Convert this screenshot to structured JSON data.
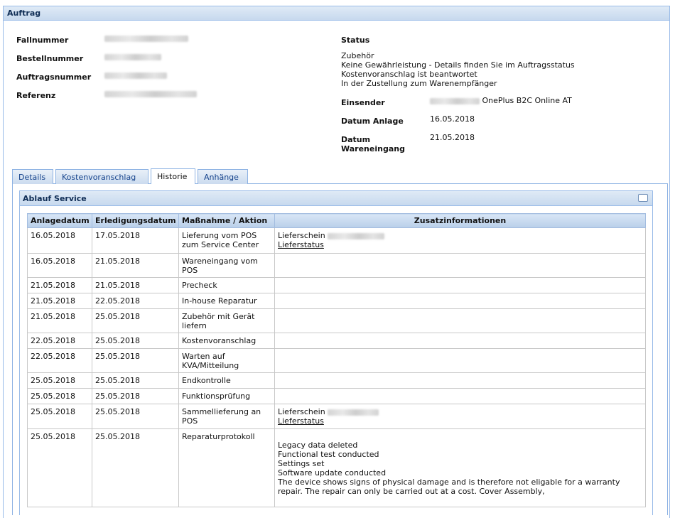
{
  "panel_title": "Auftrag",
  "fields_left": [
    {
      "label": "Fallnummer",
      "redacted": true
    },
    {
      "label": "Bestellnummer",
      "redacted": true
    },
    {
      "label": "Auftragsnummer",
      "redacted": true
    },
    {
      "label": "Referenz",
      "redacted": true
    }
  ],
  "status": {
    "label": "Status",
    "lines": [
      "Zubehör",
      "Keine Gewährleistung - Details finden Sie im Auftragsstatus",
      "Kostenvoranschlag ist beantwortet",
      "In der Zustellung zum Warenempfänger"
    ]
  },
  "einsender": {
    "label": "Einsender",
    "value": "OnePlus B2C Online AT"
  },
  "datum_anlage": {
    "label": "Datum Anlage",
    "value": "16.05.2018"
  },
  "datum_wareneingang": {
    "label_line1": "Datum",
    "label_line2": "Wareneingang",
    "value": "21.05.2018"
  },
  "tabs": [
    {
      "label": "Details",
      "active": false
    },
    {
      "label": "Kostenvoranschlag",
      "active": false
    },
    {
      "label": "Historie",
      "active": true
    },
    {
      "label": "Anhänge",
      "active": false
    }
  ],
  "service_panel": {
    "title": "Ablauf Service",
    "columns": [
      "Anlagedatum",
      "Erledigungsdatum",
      "Maßnahme / Aktion",
      "Zusatzinformationen"
    ],
    "rows": [
      {
        "anlage": "16.05.2018",
        "erledigung": "17.05.2018",
        "aktion": "Lieferung vom POS zum Service Center",
        "info_label": "Lieferschein",
        "info_link": "Lieferstatus"
      },
      {
        "anlage": "16.05.2018",
        "erledigung": "21.05.2018",
        "aktion": "Wareneingang vom POS"
      },
      {
        "anlage": "21.05.2018",
        "erledigung": "21.05.2018",
        "aktion": "Precheck"
      },
      {
        "anlage": "21.05.2018",
        "erledigung": "22.05.2018",
        "aktion": "In-house Reparatur"
      },
      {
        "anlage": "21.05.2018",
        "erledigung": "25.05.2018",
        "aktion": "Zubehör mit Gerät liefern"
      },
      {
        "anlage": "22.05.2018",
        "erledigung": "25.05.2018",
        "aktion": "Kostenvoranschlag"
      },
      {
        "anlage": "22.05.2018",
        "erledigung": "25.05.2018",
        "aktion": "Warten auf KVA/Mitteilung"
      },
      {
        "anlage": "25.05.2018",
        "erledigung": "25.05.2018",
        "aktion": "Endkontrolle"
      },
      {
        "anlage": "25.05.2018",
        "erledigung": "25.05.2018",
        "aktion": "Funktionsprüfung"
      },
      {
        "anlage": "25.05.2018",
        "erledigung": "25.05.2018",
        "aktion": "Sammellieferung an POS",
        "info_label": "Lieferschein",
        "info_link": "Lieferstatus"
      },
      {
        "anlage": "25.05.2018",
        "erledigung": "25.05.2018",
        "aktion": "Reparaturprotokoll",
        "info_lines": [
          "Legacy data deleted",
          "Functional test conducted",
          "Settings set",
          "Software update conducted",
          "The device shows signs of physical damage and is therefore not eligable for a warranty repair. The repair can only be carried out at a cost. Cover Assembly,"
        ]
      }
    ]
  }
}
